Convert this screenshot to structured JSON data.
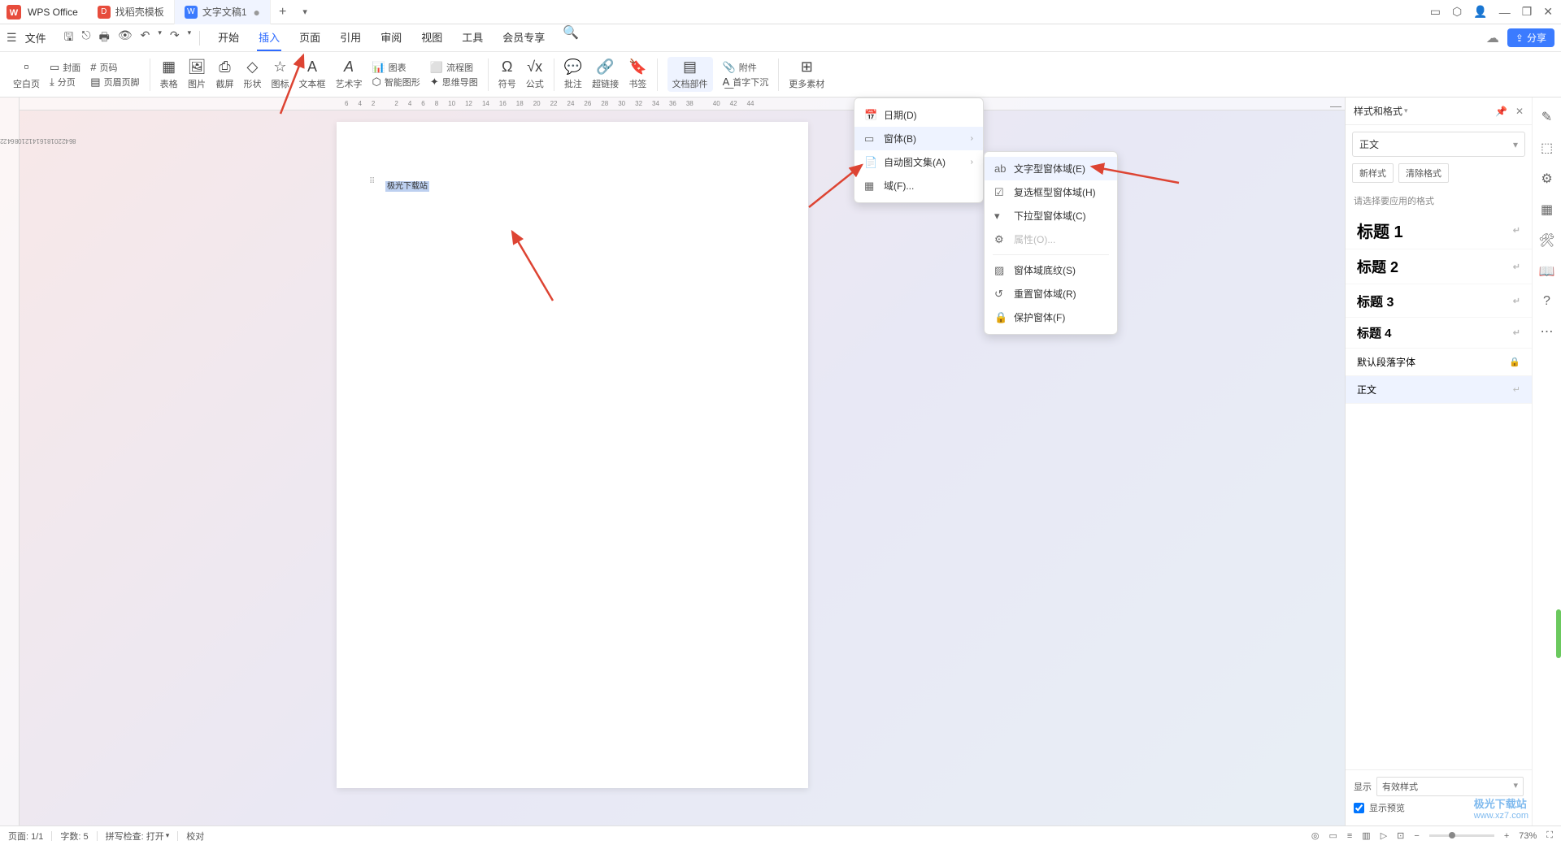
{
  "titlebar": {
    "app_name": "WPS Office",
    "tabs": [
      {
        "label": "找稻壳模板",
        "icon_bg": "#e74c3c",
        "icon_text": "D"
      },
      {
        "label": "文字文稿1",
        "icon_bg": "#3b7bff",
        "icon_text": "W",
        "active": true
      }
    ]
  },
  "menubar": {
    "file": "文件",
    "tabs": [
      "开始",
      "插入",
      "页面",
      "引用",
      "审阅",
      "视图",
      "工具",
      "会员专享"
    ],
    "active_tab": "插入",
    "share": "分享"
  },
  "ribbon": {
    "blank_page": "空白页",
    "cover": "封面",
    "page_number": "页码",
    "page_break": "分页",
    "header_footer": "页眉页脚",
    "table": "表格",
    "picture": "图片",
    "screenshot": "截屏",
    "shape": "形状",
    "icon": "图标",
    "textbox": "文本框",
    "wordart": "艺术字",
    "chart": "图表",
    "smartart": "智能图形",
    "flowchart": "流程图",
    "mindmap": "思维导图",
    "symbol": "符号",
    "equation": "公式",
    "comment": "批注",
    "hyperlink": "超链接",
    "bookmark": "书签",
    "doc_parts": "文档部件",
    "attachment": "附件",
    "dropcap": "首字下沉",
    "more": "更多素材"
  },
  "dropdown1": {
    "date": "日期(D)",
    "form": "窗体(B)",
    "autotext": "自动图文集(A)",
    "field": "域(F)..."
  },
  "dropdown2": {
    "text_form": "文字型窗体域(E)",
    "checkbox_form": "复选框型窗体域(H)",
    "dropdown_form": "下拉型窗体域(C)",
    "properties": "属性(O)...",
    "shading": "窗体域底纹(S)",
    "reset": "重置窗体域(R)",
    "protect": "保护窗体(F)"
  },
  "document": {
    "selected_text": "极光下载站"
  },
  "ruler_h": [
    "6",
    "4",
    "2",
    "",
    "2",
    "4",
    "6",
    "8",
    "10",
    "12",
    "14",
    "16",
    "18",
    "20",
    "22",
    "24",
    "26",
    "28",
    "30",
    "32",
    "34",
    "36",
    "38",
    "",
    "40",
    "42",
    "44"
  ],
  "ruler_v": [
    "",
    "2",
    "",
    "2",
    "4",
    "6",
    "8",
    "10",
    "12",
    "14",
    "16",
    "18",
    "20",
    "",
    "2",
    "4",
    "6",
    "8"
  ],
  "side_panel": {
    "title": "样式和格式",
    "current_style": "正文",
    "new_style": "新样式",
    "clear_format": "清除格式",
    "hint": "请选择要应用的格式",
    "styles": [
      {
        "label": "标题 1",
        "class": "h1"
      },
      {
        "label": "标题 2",
        "class": "h2"
      },
      {
        "label": "标题 3",
        "class": "h3"
      },
      {
        "label": "标题 4",
        "class": "h4"
      }
    ],
    "default_para": "默认段落字体",
    "body_text": "正文",
    "display_label": "显示",
    "display_value": "有效样式",
    "show_preview": "显示预览"
  },
  "statusbar": {
    "page": "页面: 1/1",
    "words": "字数: 5",
    "spellcheck": "拼写检查: 打开",
    "proofread": "校对",
    "zoom": "73%"
  },
  "watermark_url": "www.xz7.com"
}
